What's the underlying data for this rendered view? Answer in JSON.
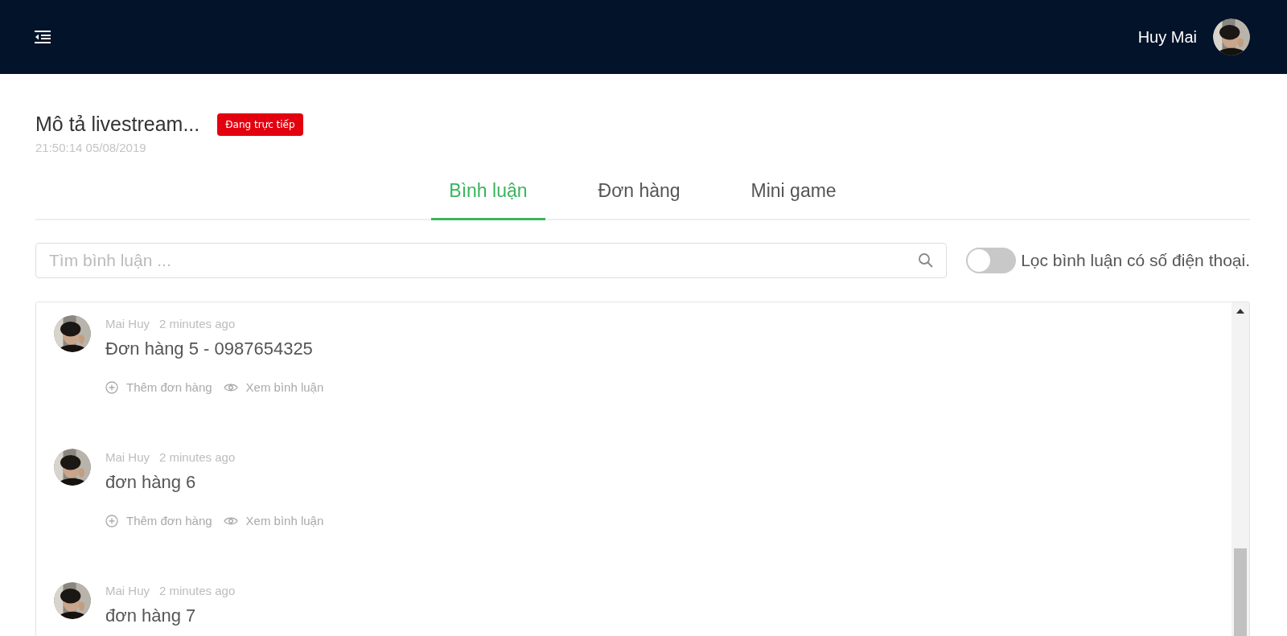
{
  "header": {
    "user_name": "Huy Mai"
  },
  "stream": {
    "title": "Mô tả livestream...",
    "badge": "Đang trực tiếp",
    "timestamp": "21:50:14 05/08/2019"
  },
  "tabs": [
    {
      "label": "Bình luận",
      "selected": true
    },
    {
      "label": "Đơn hàng",
      "selected": false
    },
    {
      "label": "Mini game",
      "selected": false
    }
  ],
  "search": {
    "placeholder": "Tìm bình luận ..."
  },
  "filter_toggle": {
    "label": "Lọc bình luận có số điện thoại.",
    "on": false
  },
  "comments": [
    {
      "author": "Mai Huy",
      "time": "2 minutes ago",
      "text": "Đơn hàng 5 - 0987654325",
      "actions": [
        {
          "kind": "add",
          "label": "Thêm đơn hàng"
        },
        {
          "kind": "view",
          "label": "Xem bình luận"
        }
      ]
    },
    {
      "author": "Mai Huy",
      "time": "2 minutes ago",
      "text": "đơn hàng 6",
      "actions": [
        {
          "kind": "add",
          "label": "Thêm đơn hàng"
        },
        {
          "kind": "view",
          "label": "Xem bình luận"
        }
      ]
    },
    {
      "author": "Mai Huy",
      "time": "2 minutes ago",
      "text": "đơn hàng 7"
    }
  ]
}
